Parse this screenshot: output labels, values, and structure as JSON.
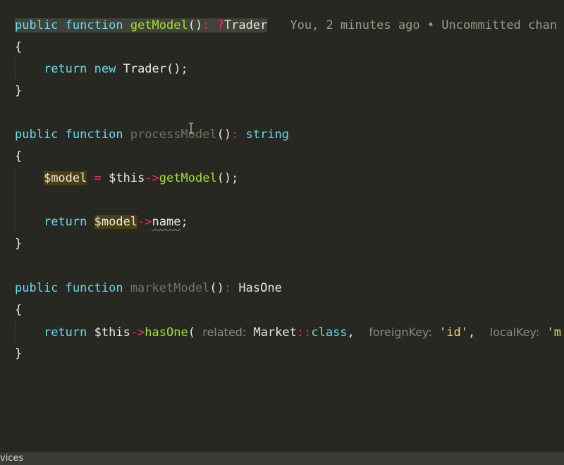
{
  "code": {
    "l1": {
      "kw1": "public",
      "kw2": "function",
      "name": "getModel",
      "parens": "()",
      "colon": ":",
      "nullable": "?",
      "ret": "Trader"
    },
    "blame": "You, 2 minutes ago • Uncommitted chan",
    "brace_open": "{",
    "brace_close": "}",
    "l2": {
      "kw": "return",
      "kw_new": "new",
      "cls": "Trader",
      "end": "();"
    },
    "l5": {
      "kw1": "public",
      "kw2": "function",
      "name": "processModel",
      "parens": "()",
      "colon": ":",
      "ret": "string"
    },
    "l7": {
      "var": "$model",
      "eq": "=",
      "this": "$this",
      "arrow": "->",
      "call": "getModel",
      "end": "();"
    },
    "l9": {
      "kw": "return",
      "var": "$model",
      "arrow": "->",
      "prop": "name",
      "end": ";"
    },
    "l12": {
      "kw1": "public",
      "kw2": "function",
      "name": "marketModel",
      "parens": "()",
      "colon": ":",
      "ret": "HasOne"
    },
    "l14": {
      "kw": "return",
      "this": "$this",
      "arrow": "->",
      "call": "hasOne",
      "paren": "(",
      "hint1": "related:",
      "arg1_cls": "Market",
      "arg1_sep": "::",
      "arg1_kw": "class",
      "comma1": ",",
      "hint2": "foreignKey:",
      "arg2": "'id'",
      "comma2": ",",
      "hint3": "localKey:",
      "arg3": "'m"
    }
  },
  "statusbar": {
    "text": "vices"
  },
  "colors": {
    "background": "#272822",
    "keyword": "#66d9ef",
    "function": "#a6e22e",
    "operator": "#f92672",
    "string": "#e6db74"
  }
}
